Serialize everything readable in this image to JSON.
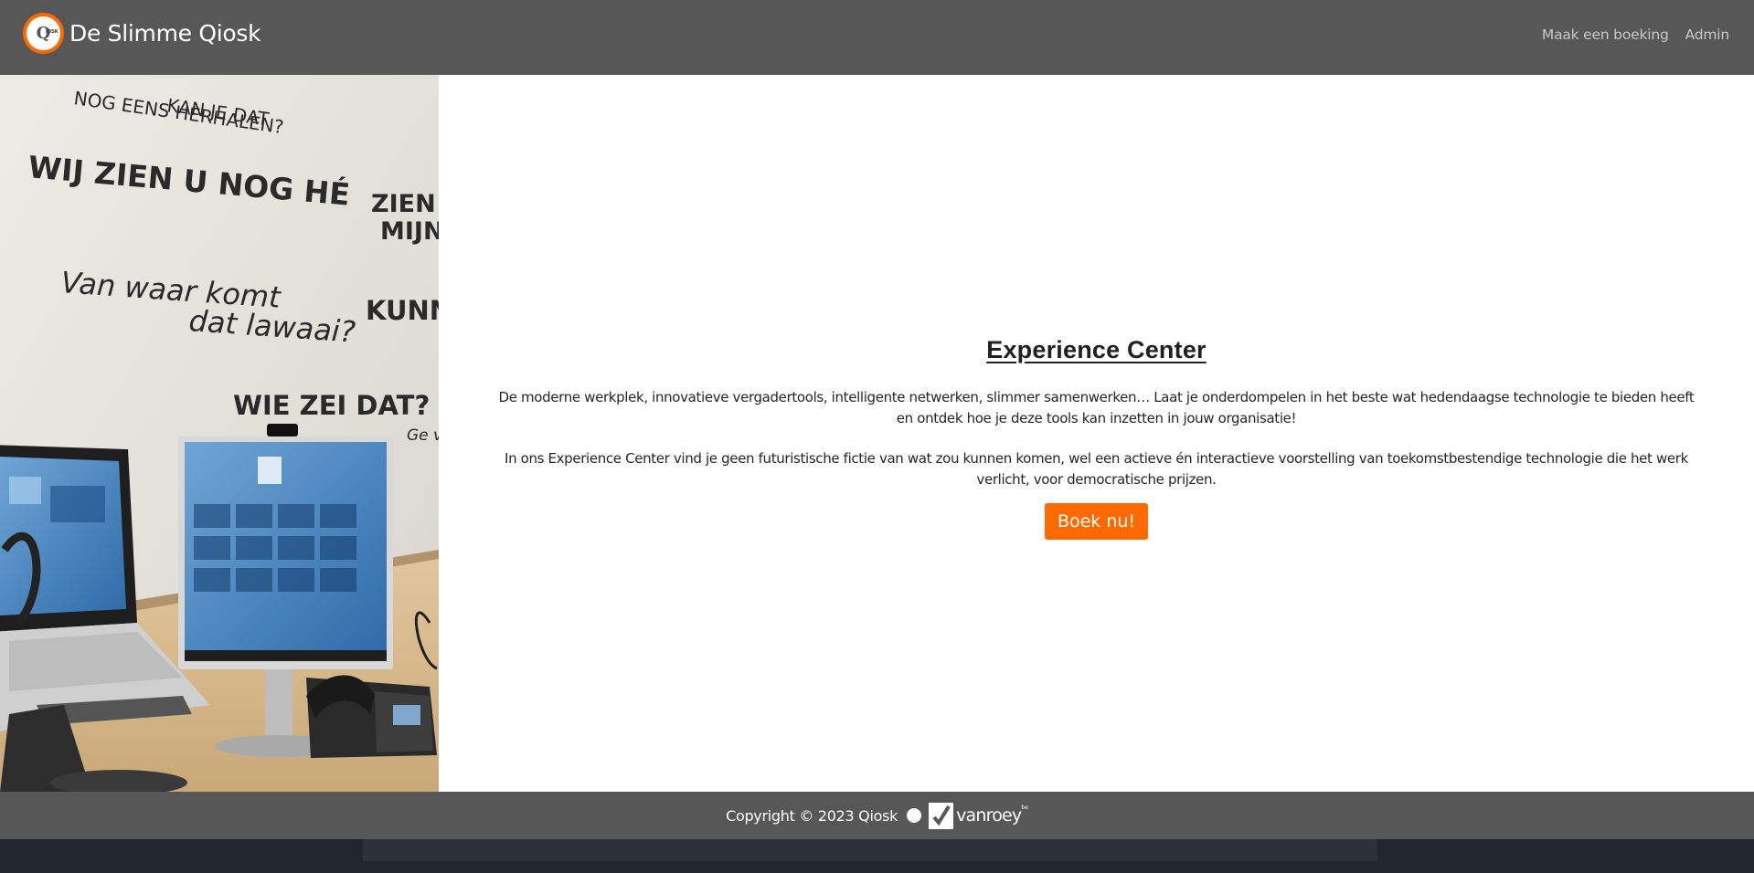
{
  "header": {
    "logo_letter": "Q",
    "logo_small": "IOSK",
    "brand_title": "De Slimme Qiosk",
    "nav": [
      {
        "label": "Maak een boeking"
      },
      {
        "label": "Admin"
      }
    ]
  },
  "hero_image": {
    "wall_texts": [
      "KAN JE DAT",
      "NOG EENS HERHALEN?",
      "WIJ ZIEN U NOG HÉ",
      "ZIEN JU",
      "MIJN S",
      "Van waar komt",
      "dat lawaai?",
      "KUNNE",
      "WIE ZEI DAT?",
      "Ge va"
    ]
  },
  "main": {
    "heading": "Experience Center",
    "paragraph1": "De moderne werkplek, innovatieve vergadertools, intelligente netwerken, slimmer samenwerken… Laat je onderdompelen in het beste wat hedendaagse technologie te bieden heeft en ontdek hoe je deze tools kan inzetten in jouw organisatie!",
    "paragraph2": "In ons Experience Center vind je geen futuristische fictie van wat zou kunnen komen, wel een actieve én interactieve voorstelling van toekomstbestendige technologie die het werk verlicht, voor democratische prijzen.",
    "cta_label": "Boek nu!"
  },
  "footer": {
    "copyright": "Copyright © 2023 Qiosk",
    "partner_name": "vanroey",
    "partner_suffix": "be"
  },
  "colors": {
    "navbar": "#575757",
    "accent": "#ff6a00",
    "page_bg": "#222630"
  }
}
